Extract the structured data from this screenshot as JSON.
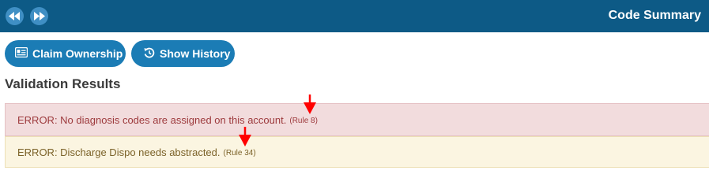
{
  "header": {
    "title": "Code Summary",
    "prev_icon": "rewind-icon",
    "next_icon": "fast-forward-icon"
  },
  "actions": {
    "claim_label": "Claim Ownership",
    "claim_icon": "id-card-icon",
    "history_label": "Show History",
    "history_icon": "history-icon"
  },
  "validation": {
    "heading": "Validation Results",
    "items": [
      {
        "message": "ERROR: No diagnosis codes are assigned on this account.",
        "rule": "(Rule 8)"
      },
      {
        "message": "ERROR: Discharge Dispo needs abstracted.",
        "rule": "(Rule 34)"
      }
    ]
  },
  "colors": {
    "header_bg": "#0d5a86",
    "button_bg": "#1b7cb5",
    "error_bg": "#f2dcdd",
    "warning_bg": "#fbf5e1",
    "annotation_arrow": "#ff0000"
  }
}
